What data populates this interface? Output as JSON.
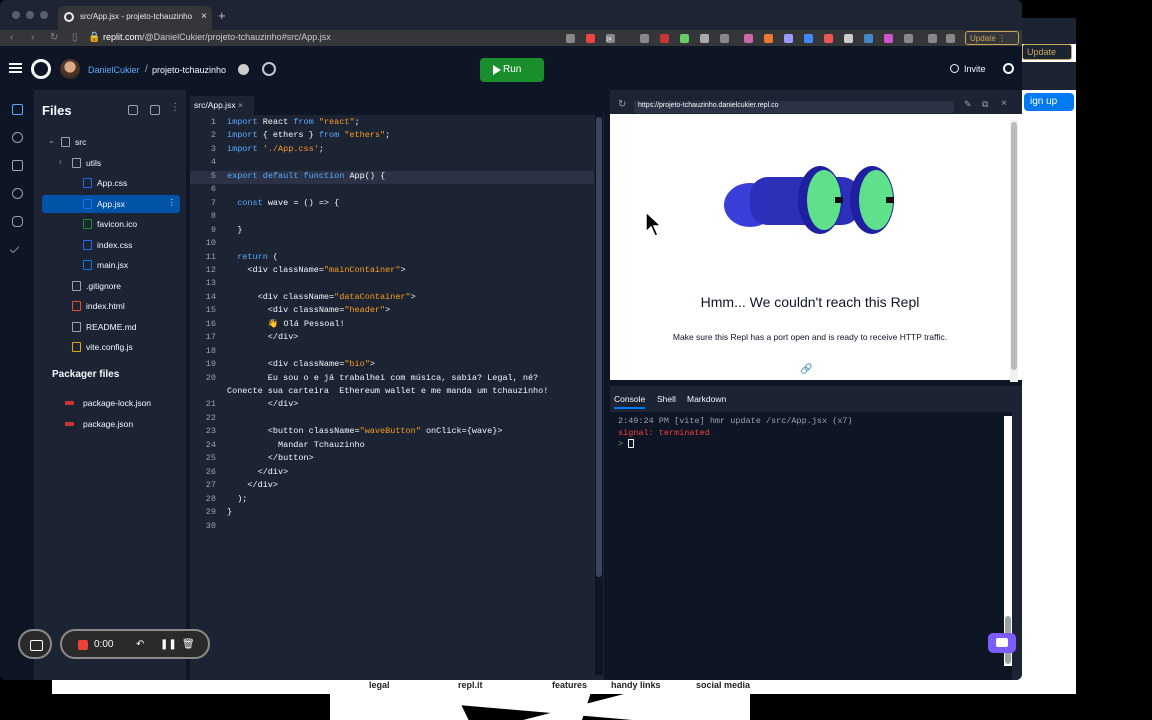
{
  "browser": {
    "tab_title": "src/App.jsx - projeto-tchauzinho",
    "url_host": "replit.com",
    "url_path": "/@DanielCukier/projeto-tchauzinho#src/App.jsx",
    "update_label": "Update",
    "ext_badge": "24"
  },
  "header": {
    "username": "DanielCukier",
    "separator": "/",
    "project": "projeto-tchauzinho",
    "run_label": "Run",
    "invite_label": "Invite"
  },
  "files": {
    "title": "Files",
    "items": [
      {
        "label": "src",
        "indent": 0,
        "type": "folder-open"
      },
      {
        "label": "utils",
        "indent": 1,
        "type": "folder"
      },
      {
        "label": "App.css",
        "indent": 2,
        "type": "css"
      },
      {
        "label": "App.jsx",
        "indent": 2,
        "type": "jsx",
        "selected": true
      },
      {
        "label": "favicon.ico",
        "indent": 2,
        "type": "ico"
      },
      {
        "label": "index.css",
        "indent": 2,
        "type": "css"
      },
      {
        "label": "main.jsx",
        "indent": 2,
        "type": "jsx"
      },
      {
        "label": ".gitignore",
        "indent": 1,
        "type": "git"
      },
      {
        "label": "index.html",
        "indent": 1,
        "type": "html"
      },
      {
        "label": "README.md",
        "indent": 1,
        "type": "md"
      },
      {
        "label": "vite.config.js",
        "indent": 1,
        "type": "js"
      }
    ],
    "packager_title": "Packager files",
    "packager_items": [
      "package-lock.json",
      "package.json"
    ]
  },
  "editor": {
    "tab_label": "src/App.jsx",
    "lines": [
      {
        "n": "1",
        "text": "import React from \"react\";"
      },
      {
        "n": "2",
        "text": "import { ethers } from \"ethers\";"
      },
      {
        "n": "3",
        "text": "import './App.css';"
      },
      {
        "n": "4",
        "text": ""
      },
      {
        "n": "5",
        "text": "export default function App() {"
      },
      {
        "n": "6",
        "text": ""
      },
      {
        "n": "7",
        "text": "  const wave = () => {"
      },
      {
        "n": "8",
        "text": ""
      },
      {
        "n": "9",
        "text": "  }"
      },
      {
        "n": "10",
        "text": ""
      },
      {
        "n": "11",
        "text": "  return ("
      },
      {
        "n": "12",
        "text": "    <div className=\"mainContainer\">"
      },
      {
        "n": "13",
        "text": ""
      },
      {
        "n": "14",
        "text": "      <div className=\"dataContainer\">"
      },
      {
        "n": "15",
        "text": "        <div className=\"header\">"
      },
      {
        "n": "16",
        "text": "        👋 Olá Pessoal!"
      },
      {
        "n": "17",
        "text": "        </div>"
      },
      {
        "n": "18",
        "text": ""
      },
      {
        "n": "19",
        "text": "        <div className=\"bio\">"
      },
      {
        "n": "20",
        "text": "        Eu sou o e já trabalhei com música, sabia? Legal, né?"
      },
      {
        "n": "",
        "text": "Conecte sua carteira  Ethereum wallet e me manda um tchauzinho!"
      },
      {
        "n": "21",
        "text": "        </div>"
      },
      {
        "n": "22",
        "text": ""
      },
      {
        "n": "23",
        "text": "        <button className=\"waveButton\" onClick={wave}>"
      },
      {
        "n": "24",
        "text": "          Mandar Tchauzinho"
      },
      {
        "n": "25",
        "text": "        </button>"
      },
      {
        "n": "26",
        "text": "      </div>"
      },
      {
        "n": "27",
        "text": "    </div>"
      },
      {
        "n": "28",
        "text": "  );"
      },
      {
        "n": "29",
        "text": "}"
      },
      {
        "n": "30",
        "text": ""
      }
    ]
  },
  "webview": {
    "url": "https://projeto-tchauzinho.danielcukier.repl.co",
    "heading": "Hmm... We couldn't reach this Repl",
    "message": "Make sure this Repl has a port open and is ready to receive HTTP traffic."
  },
  "console": {
    "tabs": [
      "Console",
      "Shell",
      "Markdown"
    ],
    "line1": "2:49:24 PM [vite] hmr update /src/App.jsx (x7)",
    "line2": "signal: terminated",
    "prompt": ">"
  },
  "recorder": {
    "time": "0:00"
  },
  "background_page": {
    "update_label": "Update",
    "signup_label": "ign up",
    "footer_links": [
      "legal",
      "repl.it",
      "features",
      "handy links",
      "social media"
    ]
  },
  "colors": {
    "accent": "#0079f2",
    "run_green": "#1a8d2c",
    "error_red": "#f23f42",
    "selected": "#0053a6"
  }
}
